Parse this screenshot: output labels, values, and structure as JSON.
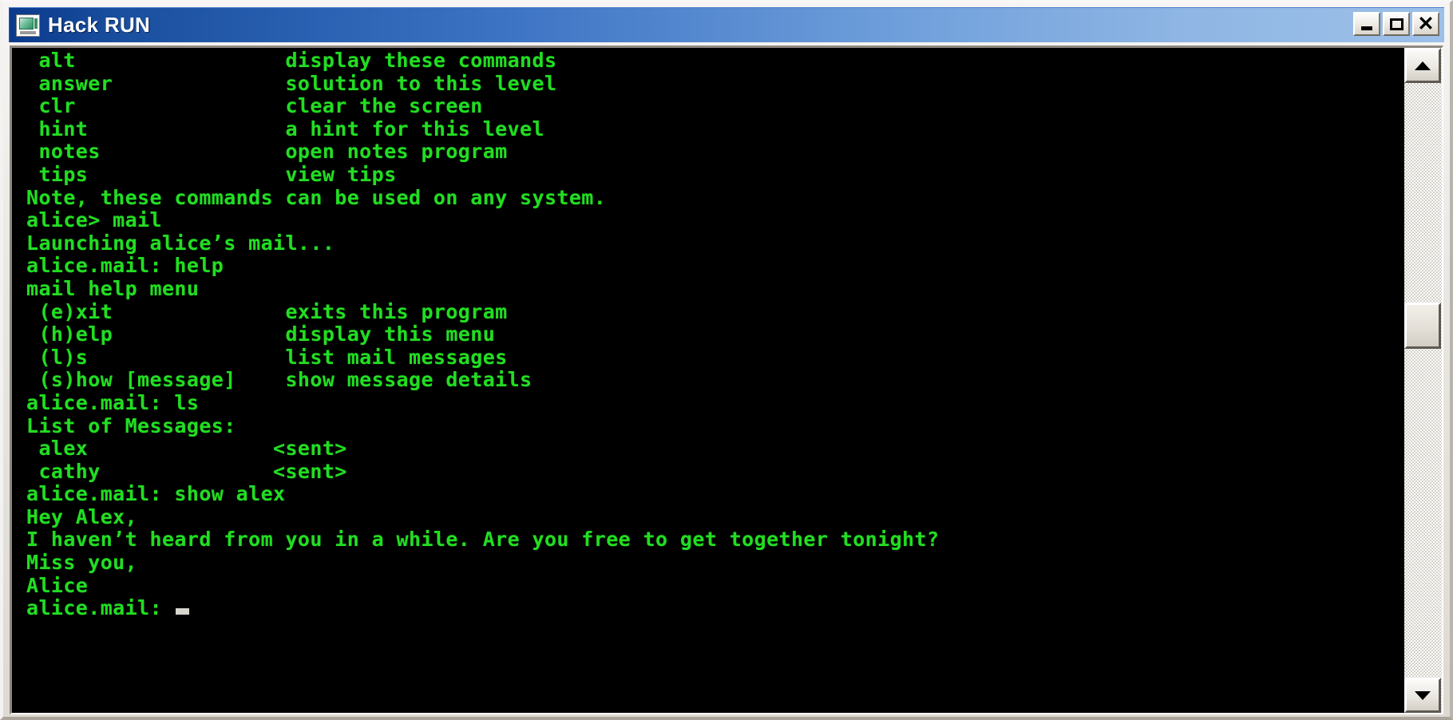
{
  "window": {
    "title": "Hack RUN",
    "icon": "app-monitor-icon",
    "buttons": {
      "minimize": "_",
      "maximize": "□",
      "close": "✕"
    }
  },
  "theme": {
    "terminal_background": "#000000",
    "terminal_text": "#22dd22",
    "titlebar_gradient_start": "#0b3a8c",
    "titlebar_gradient_end": "#9dc0e8",
    "window_chrome": "#d6d3ce",
    "cursor_color": "#d8d5cf"
  },
  "scrollbar": {
    "up_arrow": "▲",
    "down_arrow": "▼",
    "thumb_position_pct": 40
  },
  "terminal": {
    "lines": [
      " alt                 display these commands",
      " answer              solution to this level",
      " clr                 clear the screen",
      " hint                a hint for this level",
      " notes               open notes program",
      " tips                view tips",
      "Note, these commands can be used on any system.",
      "alice> mail",
      "Launching alice’s mail...",
      "alice.mail: help",
      "mail help menu",
      " (e)xit              exits this program",
      " (h)elp              display this menu",
      " (l)s                list mail messages",
      " (s)how [message]    show message details",
      "alice.mail: ls",
      "List of Messages:",
      " alex               <sent>",
      " cathy              <sent>",
      "alice.mail: show alex",
      "Hey Alex,",
      "I haven’t heard from you in a while. Are you free to get together tonight?",
      "Miss you,",
      "Alice"
    ],
    "prompt": "alice.mail: ",
    "cursor": "block"
  },
  "alt_commands": [
    {
      "command": "alt",
      "description": "display these commands"
    },
    {
      "command": "answer",
      "description": "solution to this level"
    },
    {
      "command": "clr",
      "description": "clear the screen"
    },
    {
      "command": "hint",
      "description": "a hint for this level"
    },
    {
      "command": "notes",
      "description": "open notes program"
    },
    {
      "command": "tips",
      "description": "view tips"
    }
  ],
  "mail_commands": [
    {
      "command": "(e)xit",
      "description": "exits this program"
    },
    {
      "command": "(h)elp",
      "description": "display this menu"
    },
    {
      "command": "(l)s",
      "description": "list mail messages"
    },
    {
      "command": "(s)how [message]",
      "description": "show message details"
    }
  ],
  "messages": [
    {
      "name": "alex",
      "status": "<sent>"
    },
    {
      "name": "cathy",
      "status": "<sent>"
    }
  ],
  "shown_message": {
    "greeting": "Hey Alex,",
    "body": "I haven’t heard from you in a while. Are you free to get together tonight?",
    "closing": "Miss you,",
    "signature": "Alice"
  }
}
